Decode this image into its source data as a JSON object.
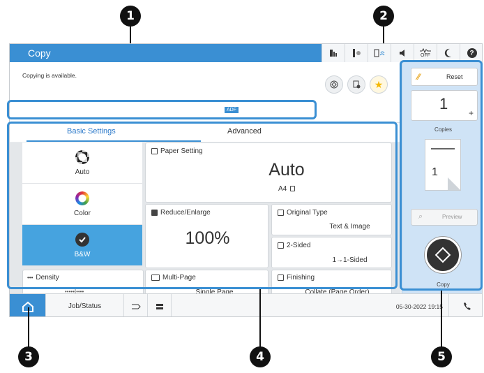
{
  "app": {
    "title": "Copy",
    "status_message": "Copying is available.",
    "adf_badge": "ADF"
  },
  "status_icons": [
    "ink-icon",
    "maintenance-icon",
    "wifi-icon",
    "speaker-icon",
    "network-off-icon",
    "moon-icon",
    "help-icon"
  ],
  "status_icon_labels": {
    "network_off": "OFF",
    "help": "?"
  },
  "tabs": [
    {
      "label": "Basic Settings",
      "active": true
    },
    {
      "label": "Advanced",
      "active": false
    }
  ],
  "color_options": [
    {
      "label": "Auto",
      "selected": false
    },
    {
      "label": "Color",
      "selected": false
    },
    {
      "label": "B&W",
      "selected": true
    }
  ],
  "density": {
    "label": "Density",
    "scale": "•••••|••••"
  },
  "paper_setting": {
    "label": "Paper Setting",
    "value": "Auto",
    "sub": "A4"
  },
  "reduce_enlarge": {
    "label": "Reduce/Enlarge",
    "value": "100%"
  },
  "original_type": {
    "label": "Original Type",
    "value": "Text & Image"
  },
  "two_sided": {
    "label": "2-Sided",
    "value": "1→1-Sided"
  },
  "multi_page": {
    "label": "Multi-Page",
    "value": "Single Page"
  },
  "finishing": {
    "label": "Finishing",
    "value": "Collate (Page Order)"
  },
  "right_panel": {
    "reset_label": "Reset",
    "copies_value": "1",
    "copies_plus": "+",
    "copies_label": "Copies",
    "preview_label": "Preview",
    "start_label": "Copy"
  },
  "bottom_bar": {
    "job_status_label": "Job/Status",
    "datetime": "05-30-2022 19:15"
  },
  "callouts": [
    "1",
    "2",
    "3",
    "4",
    "5"
  ],
  "colors": {
    "accent": "#3a8fd3",
    "selected_bg": "#46a3df",
    "callout": "#111111",
    "start_button": "#333333"
  }
}
